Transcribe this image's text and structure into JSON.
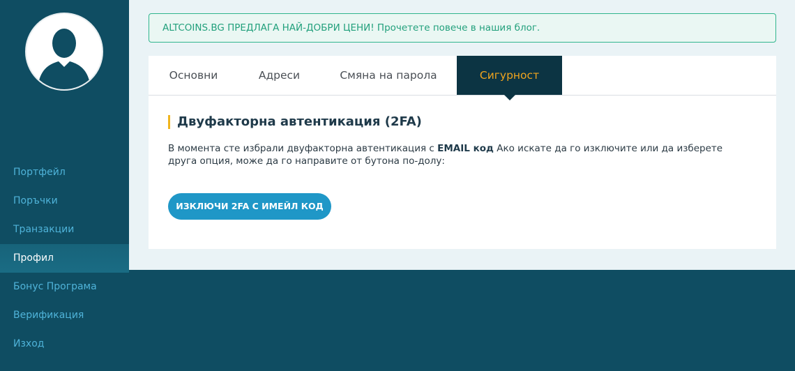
{
  "sidebar": {
    "avatar_icon": "user-silhouette-icon",
    "items": [
      {
        "label": "Портфейл"
      },
      {
        "label": "Поръчки"
      },
      {
        "label": "Транзакции"
      },
      {
        "label": "Профил",
        "active": true
      },
      {
        "label": "Бонус Програма"
      },
      {
        "label": "Верификация"
      },
      {
        "label": "Изход"
      }
    ]
  },
  "alert": {
    "text": "ALTCOINS.BG ПРЕДЛАГА НАЙ-ДОБРИ ЦЕНИ! Прочетете повече в нашия блог."
  },
  "tabs": [
    {
      "label": "Основни"
    },
    {
      "label": "Адреси"
    },
    {
      "label": "Смяна на парола"
    },
    {
      "label": "Сигурност",
      "active": true
    }
  ],
  "security": {
    "title": "Двуфакторна автентикация (2FA)",
    "desc_before": "В момента сте избрали двуфакторна автентикация с ",
    "desc_bold": "EMAIL код",
    "desc_after": " Ако искате да го изключите или да изберете друга опция, може да го направите от бутона по-долу:",
    "button_label": "ИЗКЛЮЧИ 2FA С ИМЕЙЛ КОД"
  },
  "colors": {
    "sidebar_bg": "#0f4d62",
    "nav_link": "#4fb3d9",
    "active_tab_bg": "#0c3443",
    "active_tab_text": "#f0a41e",
    "alert_green": "#22a07c",
    "button_blue": "#1f97c7",
    "title_accent": "#f0b51e"
  }
}
